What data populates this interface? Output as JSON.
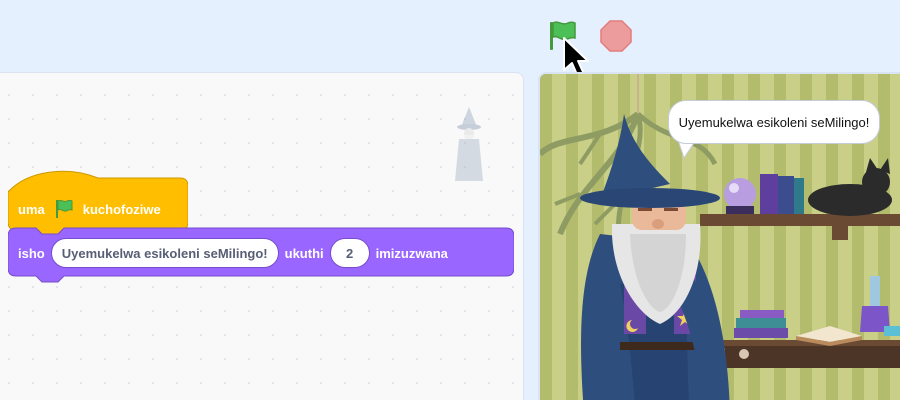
{
  "controls": {
    "green_flag_icon": "green-flag-icon",
    "stop_icon": "stop-sign-icon",
    "cursor_icon": "mouse-pointer-icon"
  },
  "code": {
    "hat_block": {
      "prefix": "uma",
      "flag_icon": "green-flag-icon",
      "suffix": "kuchofoziwe"
    },
    "say_block": {
      "label": "isho",
      "message": "Uyemukelwa esikoleni seMilingo!",
      "for_label": "ukuthi",
      "seconds": "2",
      "unit_label": "imizuzwana"
    }
  },
  "stage": {
    "speech_text": "Uyemukelwa esikoleni seMilingo!",
    "sprite": "wizard-sprite"
  },
  "colors": {
    "events_yellow": "#ffbf00",
    "looks_purple": "#9966ff",
    "flag_green": "#4cbf56",
    "stop_red": "#ec9c9c",
    "background": "#e5f0ff"
  }
}
